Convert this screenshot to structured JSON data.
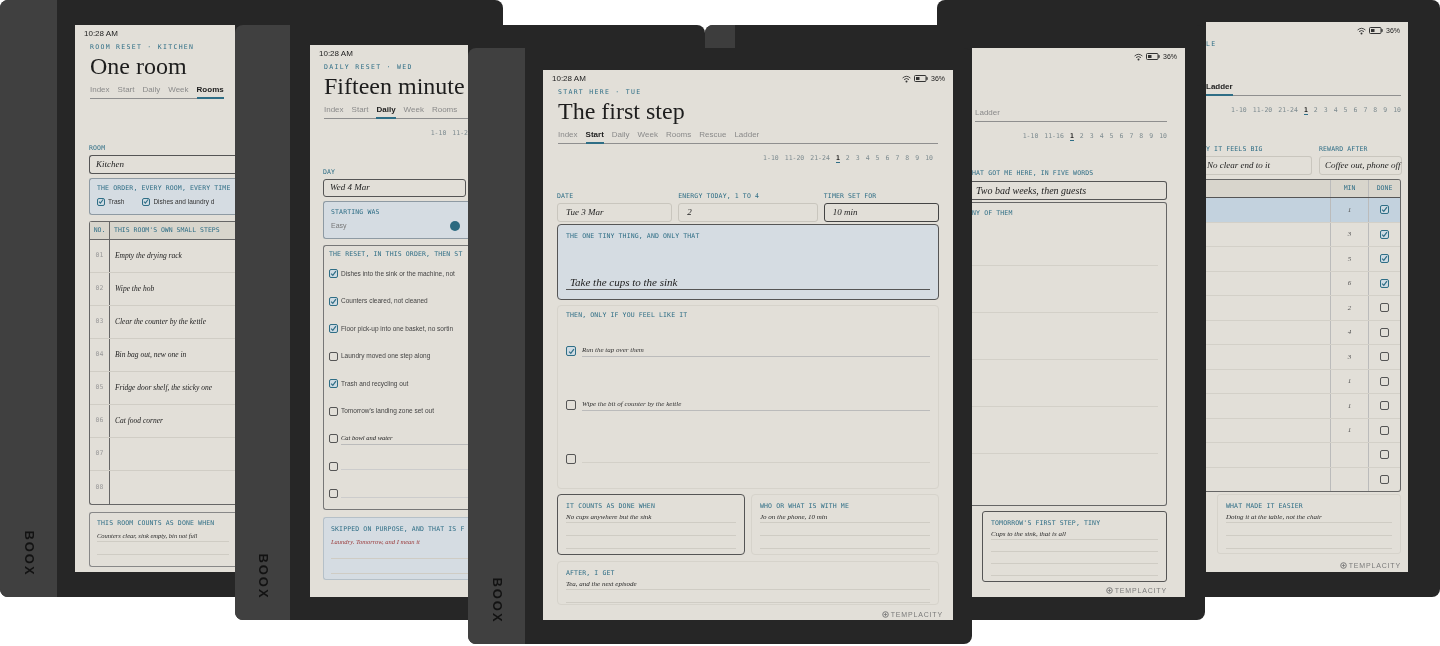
{
  "devices": [
    {
      "kind": "room",
      "brand": "BOOX",
      "time": "10:28 AM",
      "kicker": "ROOM RESET · KITCHEN",
      "title": "One room",
      "tabs": [
        {
          "label": "Index",
          "selected": false
        },
        {
          "label": "Start",
          "selected": false
        },
        {
          "label": "Daily",
          "selected": false
        },
        {
          "label": "Week",
          "selected": false
        },
        {
          "label": "Rooms",
          "selected": true
        }
      ],
      "room_field": {
        "label": "ROOM",
        "value": "Kitchen"
      },
      "order": {
        "label": "THE ORDER, EVERY ROOM, EVERY TIME",
        "items": [
          {
            "text": "Trash",
            "checked": true
          },
          {
            "text": "Dishes and laundry d",
            "checked": true
          }
        ]
      },
      "steps_table": {
        "columns": [
          "NO.",
          "THIS ROOM'S OWN SMALL STEPS"
        ],
        "rows": [
          {
            "no": "01",
            "step": "Empty the drying rack"
          },
          {
            "no": "02",
            "step": "Wipe the hob"
          },
          {
            "no": "03",
            "step": "Clear the counter by the kettle"
          },
          {
            "no": "04",
            "step": "Bin bag out, new one in"
          },
          {
            "no": "05",
            "step": "Fridge door shelf, the sticky one"
          },
          {
            "no": "06",
            "step": "Cat food corner"
          },
          {
            "no": "07"
          },
          {
            "no": "08"
          }
        ]
      },
      "done_when": {
        "label": "THIS ROOM COUNTS AS DONE WHEN",
        "text": "Counters clear, sink empty, bin not full"
      }
    },
    {
      "kind": "daily",
      "brand": "BOOX",
      "time": "10:28 AM",
      "kicker": "DAILY RESET · WED",
      "title": "Fifteen minute",
      "tabs": [
        {
          "label": "Index",
          "selected": false
        },
        {
          "label": "Start",
          "selected": false
        },
        {
          "label": "Daily",
          "selected": true
        },
        {
          "label": "Week",
          "selected": false
        },
        {
          "label": "Rooms",
          "selected": false
        }
      ],
      "pages": [
        {
          "label": "1-10",
          "selected": false
        },
        {
          "label": "11-2",
          "selected": false
        }
      ],
      "day_field": {
        "label": "DAY",
        "value": "Wed 4 Mar"
      },
      "starting": {
        "label": "STARTING WAS",
        "scale_label": "Easy"
      },
      "reset": {
        "label": "THE RESET, IN THIS ORDER, THEN ST",
        "items": [
          {
            "kind": "printed",
            "text": "Dishes into the sink or the machine, not",
            "checked": true
          },
          {
            "kind": "printed",
            "text": "Counters cleared, not cleaned",
            "checked": true
          },
          {
            "kind": "printed",
            "text": "Floor pick-up into one basket, no sortin",
            "checked": true
          },
          {
            "kind": "printed",
            "text": "Laundry moved one step along",
            "checked": false
          },
          {
            "kind": "printed",
            "text": "Trash and recycling out",
            "checked": true
          },
          {
            "kind": "printed",
            "text": "Tomorrow's landing zone set out",
            "checked": false
          },
          {
            "kind": "written",
            "text": "Cat bowl and water",
            "checked": false
          },
          {
            "kind": "written",
            "checked": false
          },
          {
            "kind": "written",
            "checked": false
          }
        ]
      },
      "skipped": {
        "label": "SKIPPED ON PURPOSE, AND THAT IS F",
        "text": "Laundry. Tomorrow, and I mean it"
      }
    },
    {
      "kind": "start",
      "brand": "BOOX",
      "time": "10:28 AM",
      "battery": "36%",
      "kicker": "START HERE · TUE",
      "title": "The first step",
      "tabs": [
        {
          "label": "Index",
          "selected": false
        },
        {
          "label": "Start",
          "selected": true
        },
        {
          "label": "Daily",
          "selected": false
        },
        {
          "label": "Week",
          "selected": false
        },
        {
          "label": "Rooms",
          "selected": false
        },
        {
          "label": "Rescue",
          "selected": false
        },
        {
          "label": "Ladder",
          "selected": false
        }
      ],
      "pages": [
        {
          "label": "1-10",
          "selected": false
        },
        {
          "label": "11-20",
          "selected": false
        },
        {
          "label": "21-24",
          "selected": false
        },
        {
          "label": "1",
          "selected": true
        },
        {
          "label": "2",
          "selected": false
        },
        {
          "label": "3",
          "selected": false
        },
        {
          "label": "4",
          "selected": false
        },
        {
          "label": "5",
          "selected": false
        },
        {
          "label": "6",
          "selected": false
        },
        {
          "label": "7",
          "selected": false
        },
        {
          "label": "8",
          "selected": false
        },
        {
          "label": "9",
          "selected": false
        },
        {
          "label": "10",
          "selected": false
        }
      ],
      "fields": [
        {
          "label": "DATE",
          "value": "Tue 3 Mar",
          "focused": false
        },
        {
          "label": "ENERGY TODAY, 1 TO 4",
          "value": "2",
          "focused": false
        },
        {
          "label": "TIMER SET FOR",
          "value": "10 min",
          "focused": true
        }
      ],
      "tiny_thing": {
        "label": "THE ONE TINY THING, AND ONLY THAT",
        "text": "Take the cups to the sink"
      },
      "optional": {
        "label": "THEN, ONLY IF YOU FEEL LIKE IT",
        "items": [
          {
            "text": "Run the tap over them",
            "checked": true
          },
          {
            "text": "Wipe the bit of counter by the kettle",
            "checked": false
          },
          {
            "checked": false
          }
        ]
      },
      "notes": [
        {
          "label": "IT COUNTS AS DONE WHEN",
          "text": "No cups anywhere but the sink",
          "focused": true
        },
        {
          "label": "WHO OR WHAT IS WITH ME",
          "text": "Jo on the phone, 10 min",
          "focused": false
        }
      ],
      "after": {
        "label": "AFTER, I GET",
        "text": "Tea, and the next episode"
      },
      "footer": "TEMPLACITY"
    },
    {
      "kind": "rescue",
      "battery": "36%",
      "tabs": [
        {
          "label": "Ladder",
          "selected": false
        }
      ],
      "pages": [
        {
          "label": "1-10",
          "selected": false
        },
        {
          "label": "11-16",
          "selected": false
        },
        {
          "label": "1",
          "selected": true
        },
        {
          "label": "2",
          "selected": false
        },
        {
          "label": "3",
          "selected": false
        },
        {
          "label": "4",
          "selected": false
        },
        {
          "label": "5",
          "selected": false
        },
        {
          "label": "6",
          "selected": false
        },
        {
          "label": "7",
          "selected": false
        },
        {
          "label": "8",
          "selected": false
        },
        {
          "label": "9",
          "selected": false
        },
        {
          "label": "10",
          "selected": false
        }
      ],
      "cause_field": {
        "label": "HAT GOT ME HERE, IN FIVE WORDS",
        "value": "Two bad weeks, then guests"
      },
      "list": {
        "label": "NY OF THEM"
      },
      "tomorrow": {
        "label": "TOMORROW'S FIRST STEP, TINY",
        "text": "Cups to the sink, that is all"
      },
      "footer": "TEMPLACITY"
    },
    {
      "kind": "ladder",
      "battery": "36%",
      "kicker": "LE",
      "tabs": [
        {
          "label": "Ladder",
          "selected": true
        }
      ],
      "pages": [
        {
          "label": "1-10",
          "selected": false
        },
        {
          "label": "11-20",
          "selected": false
        },
        {
          "label": "21-24",
          "selected": false
        },
        {
          "label": "1",
          "selected": true
        },
        {
          "label": "2",
          "selected": false
        },
        {
          "label": "3",
          "selected": false
        },
        {
          "label": "4",
          "selected": false
        },
        {
          "label": "5",
          "selected": false
        },
        {
          "label": "6",
          "selected": false
        },
        {
          "label": "7",
          "selected": false
        },
        {
          "label": "8",
          "selected": false
        },
        {
          "label": "9",
          "selected": false
        },
        {
          "label": "10",
          "selected": false
        }
      ],
      "fields": [
        {
          "label": "Y IT FEELS BIG",
          "value": "No clear end to it"
        },
        {
          "label": "REWARD AFTER",
          "value": "Coffee out, phone off"
        }
      ],
      "table": {
        "columns": [
          "MIN",
          "DONE"
        ],
        "rows": [
          {
            "min": "1",
            "done": true,
            "selected": true
          },
          {
            "min": "3",
            "done": true,
            "selected": false
          },
          {
            "min": "5",
            "done": true,
            "selected": false
          },
          {
            "min": "6",
            "done": true,
            "selected": false
          },
          {
            "min": "2",
            "done": false,
            "selected": false
          },
          {
            "min": "4",
            "done": false,
            "selected": false
          },
          {
            "min": "3",
            "done": false,
            "selected": false
          },
          {
            "min": "1",
            "done": false,
            "selected": false
          },
          {
            "min": "1",
            "done": false,
            "selected": false
          },
          {
            "min": "1",
            "done": false,
            "selected": false
          },
          {
            "done": false,
            "selected": false
          },
          {
            "done": false,
            "selected": false
          }
        ]
      },
      "easier": {
        "label": "WHAT MADE IT EASIER",
        "text": "Doing it at the table, not the chair"
      },
      "footer": "TEMPLACITY"
    }
  ]
}
